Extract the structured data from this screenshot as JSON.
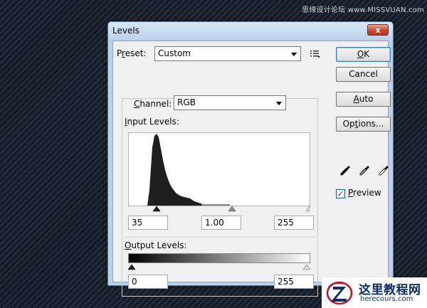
{
  "watermark": "思缘设计论坛 www.MISSVUAN.com",
  "dialog": {
    "title": "Levels",
    "close_label": "x",
    "preset": {
      "label_pre": "P",
      "label_u": "r",
      "label_post": "eset:",
      "value": "Custom"
    },
    "buttons": {
      "ok": {
        "pre": "",
        "u": "O",
        "post": "K"
      },
      "cancel": {
        "pre": "",
        "u": "",
        "post": "Cancel"
      },
      "auto": {
        "pre": "",
        "u": "A",
        "post": "uto"
      },
      "options": {
        "pre": "Op",
        "u": "t",
        "post": "ions..."
      }
    },
    "channel": {
      "label_pre": "",
      "label_u": "C",
      "label_post": "hannel:",
      "value": "RGB"
    },
    "input_levels": {
      "label_pre": "",
      "label_u": "I",
      "label_post": "nput Levels:",
      "shadow": "35",
      "midtone": "1.00",
      "highlight": "255"
    },
    "output_levels": {
      "label_pre": "",
      "label_u": "O",
      "label_post": "utput Levels:",
      "shadow": "0",
      "highlight": "255"
    },
    "preview": {
      "label_pre": "",
      "label_u": "P",
      "label_post": "review",
      "checked": true,
      "check_mark": "✓"
    }
  },
  "logo": {
    "cn": "这里教程网",
    "en": "herecours.com"
  },
  "colors": {
    "accent": "#3c7fb1",
    "titlebar": "#bcd3ec",
    "close": "#c44a30"
  }
}
